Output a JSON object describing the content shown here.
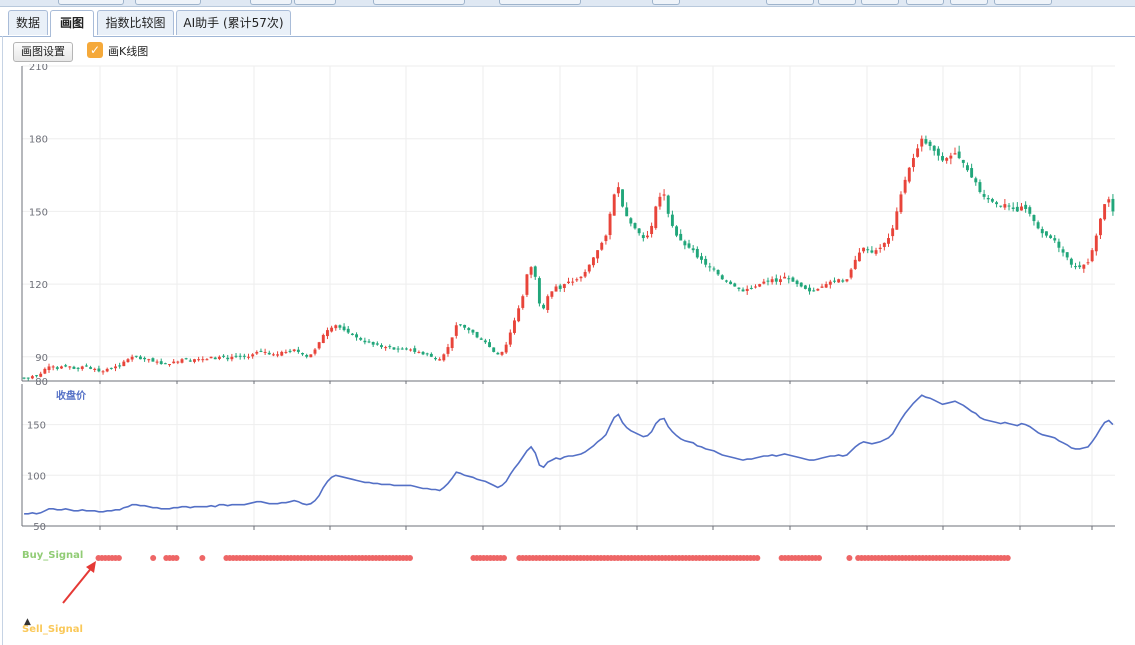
{
  "tabs": [
    {
      "label": "数据",
      "active": false
    },
    {
      "label": "画图",
      "active": true
    },
    {
      "label": "指数比较图",
      "active": false
    },
    {
      "label": "AI助手 (累计57次)",
      "active": false
    }
  ],
  "toolbar": {
    "settings_label": "画图设置",
    "kline_checkbox_label": "画K线图",
    "kline_checked": true
  },
  "colors": {
    "up": "#e8443a",
    "down": "#21a67a",
    "line": "#5470c6",
    "signal_dot": "#ee6666",
    "buy_label": "#91cc75",
    "sell_label": "#fac858",
    "arrow": "#e53935"
  },
  "chart_data": [
    {
      "type": "candlestick",
      "title": "",
      "y_ticks": [
        "80",
        "90",
        "120",
        "150",
        "180",
        "210"
      ],
      "ylim": [
        80,
        210
      ],
      "grid": true,
      "ohlc_note": "approximate daily closes traced from the candlestick panel",
      "closes": [
        81,
        81,
        82,
        82,
        83,
        85,
        86,
        86,
        85,
        86,
        86,
        86,
        85,
        85,
        86,
        86,
        85,
        85,
        84,
        84,
        85,
        85,
        86,
        86,
        88,
        89,
        90,
        90,
        89,
        89,
        89,
        88,
        88,
        87,
        87,
        87,
        88,
        88,
        89,
        89,
        88,
        89,
        89,
        89,
        89,
        90,
        89,
        90,
        90,
        89,
        90,
        90,
        90,
        90,
        90,
        91,
        92,
        92,
        92,
        91,
        91,
        91,
        92,
        92,
        92,
        93,
        92,
        91,
        90,
        91,
        93,
        96,
        99,
        101,
        102,
        103,
        102,
        101,
        100,
        99,
        98,
        97,
        96,
        96,
        95,
        95,
        94,
        94,
        94,
        93,
        93,
        93,
        93,
        93,
        92,
        92,
        91,
        91,
        90,
        89,
        89,
        91,
        94,
        98,
        103,
        103,
        102,
        101,
        100,
        98,
        97,
        96,
        94,
        92,
        91,
        92,
        95,
        100,
        105,
        110,
        115,
        124,
        127,
        123,
        112,
        110,
        115,
        117,
        119,
        118,
        120,
        121,
        121,
        122,
        123,
        125,
        128,
        131,
        134,
        137,
        140,
        149,
        157,
        160,
        152,
        148,
        145,
        143,
        141,
        139,
        140,
        144,
        152,
        156,
        157,
        149,
        144,
        140,
        138,
        136,
        135,
        134,
        131,
        130,
        128,
        127,
        126,
        124,
        122,
        121,
        120,
        119,
        118,
        117,
        118,
        118,
        119,
        120,
        121,
        121,
        122,
        121,
        122,
        123,
        122,
        121,
        120,
        119,
        118,
        117,
        117,
        118,
        119,
        120,
        121,
        121,
        122,
        121,
        122,
        126,
        130,
        133,
        135,
        134,
        133,
        134,
        135,
        137,
        139,
        143,
        150,
        157,
        163,
        168,
        172,
        176,
        180,
        178,
        177,
        175,
        173,
        171,
        172,
        173,
        174,
        172,
        170,
        167,
        164,
        162,
        158,
        156,
        155,
        154,
        153,
        152,
        153,
        152,
        151,
        150,
        152,
        151,
        149,
        146,
        143,
        141,
        140,
        139,
        138,
        135,
        133,
        131,
        128,
        127,
        127,
        128,
        129,
        134,
        140,
        147,
        153,
        155,
        150
      ],
      "volatility_note": "wick/body sizes are rendered procedurally"
    },
    {
      "type": "line",
      "title": "",
      "series": [
        {
          "name": "收盘价"
        }
      ],
      "y_ticks": [
        "50",
        "100",
        "150"
      ],
      "ylim": [
        50,
        190
      ],
      "grid": true,
      "values": [
        62,
        62,
        63,
        62,
        63,
        65,
        67,
        67,
        66,
        66,
        67,
        66,
        65,
        65,
        66,
        65,
        65,
        65,
        64,
        64,
        65,
        65,
        66,
        66,
        68,
        69,
        71,
        71,
        70,
        70,
        69,
        68,
        68,
        67,
        67,
        67,
        68,
        68,
        69,
        69,
        68,
        69,
        69,
        69,
        69,
        70,
        69,
        71,
        71,
        70,
        71,
        71,
        71,
        71,
        72,
        73,
        74,
        74,
        73,
        72,
        72,
        72,
        73,
        73,
        74,
        75,
        74,
        72,
        71,
        72,
        75,
        80,
        88,
        94,
        98,
        100,
        99,
        98,
        97,
        96,
        95,
        94,
        93,
        93,
        92,
        92,
        91,
        91,
        91,
        90,
        90,
        90,
        90,
        90,
        89,
        88,
        87,
        87,
        86,
        86,
        85,
        88,
        92,
        97,
        103,
        102,
        100,
        99,
        98,
        96,
        95,
        94,
        92,
        90,
        88,
        90,
        94,
        101,
        107,
        112,
        118,
        124,
        128,
        122,
        110,
        108,
        113,
        115,
        117,
        116,
        118,
        119,
        119,
        120,
        121,
        123,
        126,
        129,
        133,
        136,
        140,
        149,
        157,
        160,
        152,
        147,
        144,
        142,
        140,
        138,
        139,
        143,
        151,
        155,
        156,
        148,
        143,
        139,
        136,
        134,
        133,
        132,
        129,
        128,
        126,
        125,
        124,
        122,
        120,
        119,
        118,
        117,
        116,
        115,
        116,
        116,
        117,
        118,
        119,
        119,
        120,
        119,
        120,
        121,
        120,
        119,
        118,
        117,
        116,
        115,
        115,
        116,
        117,
        118,
        119,
        119,
        120,
        119,
        120,
        124,
        128,
        131,
        133,
        132,
        131,
        132,
        133,
        135,
        137,
        141,
        148,
        155,
        161,
        166,
        171,
        175,
        179,
        177,
        176,
        174,
        172,
        170,
        171,
        172,
        173,
        171,
        169,
        166,
        163,
        161,
        157,
        155,
        154,
        153,
        152,
        151,
        152,
        151,
        150,
        149,
        151,
        150,
        148,
        145,
        142,
        140,
        139,
        138,
        137,
        134,
        132,
        130,
        127,
        126,
        126,
        127,
        128,
        133,
        139,
        146,
        152,
        154,
        150
      ]
    },
    {
      "type": "scatter",
      "title": "",
      "series": [
        {
          "name": "Buy_Signal",
          "segments": [
            [
              0.07,
              0.09
            ],
            [
              0.12,
              0.12
            ],
            [
              0.132,
              0.142
            ],
            [
              0.165,
              0.165
            ],
            [
              0.187,
              0.356
            ],
            [
              0.413,
              0.442
            ],
            [
              0.455,
              0.674
            ],
            [
              0.695,
              0.73
            ],
            [
              0.757,
              0.757
            ],
            [
              0.765,
              0.903
            ]
          ]
        },
        {
          "name": "Sell_Signal",
          "segments": []
        }
      ],
      "x_note": "segments are fractions of the time axis where signal dots are drawn"
    }
  ]
}
